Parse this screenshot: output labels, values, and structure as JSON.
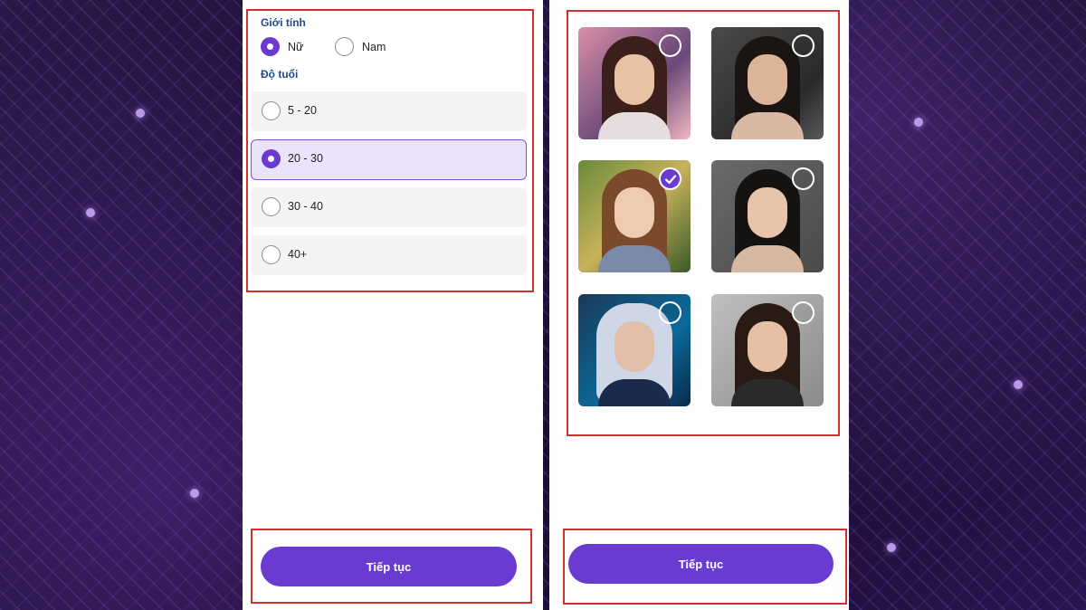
{
  "form": {
    "gender_label": "Giới tính",
    "gender_options": [
      {
        "label": "Nữ",
        "selected": true
      },
      {
        "label": "Nam",
        "selected": false
      }
    ],
    "age_label": "Độ tuổi",
    "age_options": [
      {
        "label": "5 - 20",
        "selected": false
      },
      {
        "label": "20 - 30",
        "selected": true
      },
      {
        "label": "30 - 40",
        "selected": false
      },
      {
        "label": "40+",
        "selected": false
      }
    ],
    "continue_label": "Tiếp tục"
  },
  "gallery": {
    "avatars": [
      {
        "selected": false
      },
      {
        "selected": false
      },
      {
        "selected": true
      },
      {
        "selected": false
      },
      {
        "selected": false
      },
      {
        "selected": false
      }
    ],
    "continue_label": "Tiếp tục"
  },
  "colors": {
    "accent": "#6a3bd0",
    "highlight": "#d32f2f",
    "selected_bg": "#ebe3fb"
  }
}
